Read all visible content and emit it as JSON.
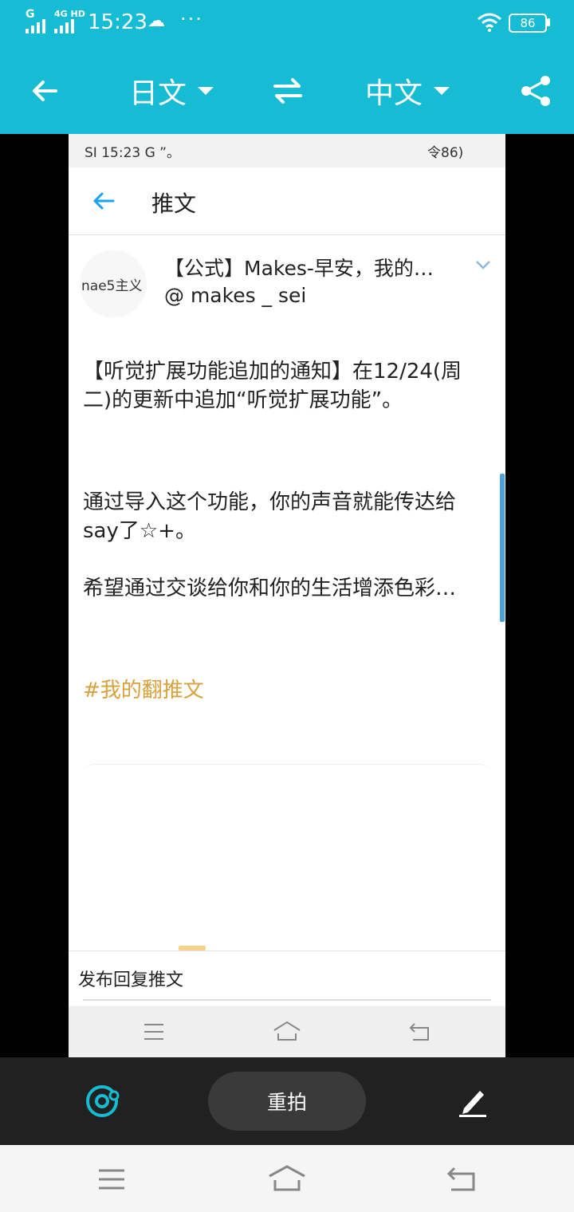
{
  "status_bar": {
    "signal_1": "G",
    "signal_2": "4G HD",
    "time": "15:23",
    "more": "···",
    "battery": "86"
  },
  "toolbar": {
    "source_lang": "日文",
    "target_lang": "中文",
    "icons": [
      "back-arrow-icon",
      "swap-icon",
      "share-icon"
    ]
  },
  "capture": {
    "status_left": "SI 15:23 G ”。",
    "status_right": "令86)",
    "title": "推文",
    "avatar_text": "nae5主义",
    "tweet_head": "【公式】Makes-早安，我的…@ makes _ sei",
    "paragraph1": "【听觉扩展功能追加的通知】在12/24(周二)的更新中追加“听觉扩展功能”。",
    "paragraph2": "通过导入这个功能，你的声音就能传达给say了☆+。",
    "paragraph3": "希望通过交谈给你和你的生活增添色彩…",
    "hashtag": "#我的翻推文",
    "reply_placeholder": "发布回复推文"
  },
  "actions": {
    "retake": "重拍"
  },
  "colors": {
    "accent": "#16bcd4",
    "hashtag": "#d9a13e",
    "link_blue": "#1da1f2"
  }
}
